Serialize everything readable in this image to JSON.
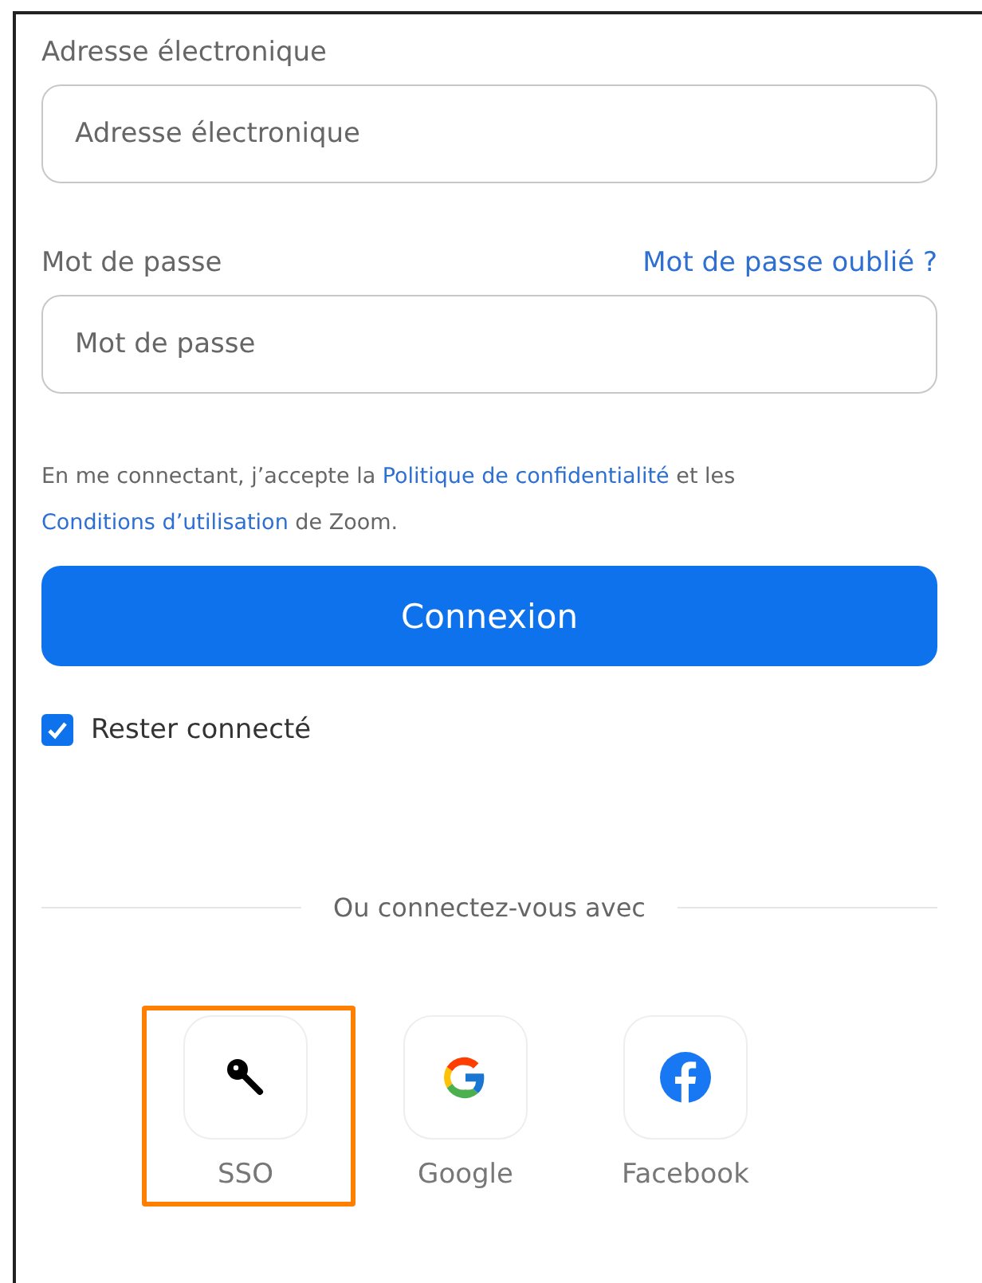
{
  "email": {
    "label": "Adresse électronique",
    "placeholder": "Adresse électronique"
  },
  "password": {
    "label": "Mot de passe",
    "forgot_link": "Mot de passe oublié ?",
    "placeholder": "Mot de passe"
  },
  "terms": {
    "before": "En me connectant, j’accepte la",
    "privacy_link": "Politique de confidentialité",
    "middle": "et les",
    "conditions_link": "Conditions d’utilisation",
    "after": "de Zoom."
  },
  "sign_in_button": "Connexion",
  "stay_signed_in": {
    "label": "Rester connecté",
    "checked": true
  },
  "divider_text": "Ou connectez-vous avec",
  "providers": [
    {
      "kind": "sso",
      "label": "SSO",
      "highlighted": true
    },
    {
      "kind": "google",
      "label": "Google",
      "highlighted": false
    },
    {
      "kind": "facebook",
      "label": "Facebook",
      "highlighted": false
    }
  ]
}
